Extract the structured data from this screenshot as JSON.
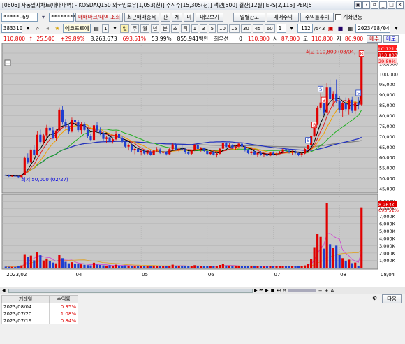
{
  "window": {
    "title": "[0606] 자동일지차트(매매내역) - KOSDAQ150 외국인보유[1,053(천)] 주식수[15,305(천)] 액면[500] 결산[12월] EPS[2,115] PER[5"
  },
  "toolbar1": {
    "account_value": "*****-69",
    "password_value": "********",
    "trade_button": "매매마크/내역 조회",
    "recent_button": "최근매매종목",
    "bal_button": "잔",
    "unexec_button": "체",
    "unexec2_button": "미",
    "memo_button": "매모보기",
    "daily_button": "일별잔고",
    "trade_profit_button": "매매수익",
    "yield_button": "수익률추이",
    "autoreg_label": "계좌연동"
  },
  "toolbar2": {
    "code_value": "383310",
    "stock_name": "에코프로에",
    "period_buttons": [
      "주",
      "월",
      "년",
      "분",
      "초",
      "틱"
    ],
    "interval_buttons": [
      "1",
      "3",
      "5",
      "10",
      "15",
      "30",
      "45",
      "60"
    ],
    "interval_input": "1",
    "count_value": "112",
    "count_total": "/543",
    "date_value": "2023/08/04"
  },
  "quote": {
    "price": "110,800",
    "arrow": "↑",
    "change": "25,500",
    "change_pct": "+29.89%",
    "volume": "8,263,673",
    "vol_ratio": "693.51%",
    "turnover": "53.99%",
    "amount": "855,941백만",
    "fund_label": "최우선",
    "prev": "0",
    "open_price": "110,800",
    "open_label": "시",
    "open_value": "87,800",
    "high_label": "고",
    "high_value": "110,800",
    "low_label": "저",
    "low_value": "86,900",
    "buy_button": "매수",
    "sell_button": "매도"
  },
  "chart_data": {
    "type": "candlestick",
    "price_axis": {
      "min": 45000,
      "max": 110000,
      "ticks": [
        "110,000",
        "105,000",
        "100,000",
        "95,000",
        "90,000",
        "85,000",
        "80,000",
        "75,000",
        "70,000",
        "65,000",
        "60,000",
        "55,000",
        "50,000",
        "45,000"
      ]
    },
    "volume_axis": {
      "ticks": [
        "9,000K",
        "8,000K",
        "7,000K",
        "6,000K",
        "5,000K",
        "4,000K",
        "3,000K",
        "2,000K",
        "1,000K"
      ]
    },
    "x_ticks": [
      "2023/02",
      "04",
      "05",
      "06",
      "07",
      "08"
    ],
    "right_labels": [
      "LC:121,60",
      "110,800",
      "29,89%"
    ],
    "volume_right_labels": [
      "8,263K",
      "693.51%"
    ],
    "bottom_right_label": "08/04",
    "annotations": {
      "high": "최고 110,800 (08/04)",
      "low": "최저 50,000 (02/27)"
    },
    "candles": [
      [
        51600,
        52000,
        51000,
        51400
      ],
      [
        51400,
        51800,
        50600,
        51000
      ],
      [
        51000,
        51500,
        50700,
        51200
      ],
      [
        51200,
        51600,
        50800,
        51100
      ],
      [
        51100,
        51300,
        50000,
        50600
      ],
      [
        50600,
        51800,
        50500,
        51700
      ],
      [
        51700,
        60500,
        51600,
        59800
      ],
      [
        59800,
        62000,
        56800,
        57600
      ],
      [
        57600,
        64800,
        57200,
        63800
      ],
      [
        63800,
        66000,
        60800,
        61300
      ],
      [
        61300,
        72800,
        61000,
        70900
      ],
      [
        70900,
        73300,
        66500,
        67400
      ],
      [
        67400,
        71500,
        66200,
        70600
      ],
      [
        70600,
        75600,
        69200,
        74200
      ],
      [
        74200,
        78000,
        72100,
        73000
      ],
      [
        73000,
        74600,
        68700,
        69400
      ],
      [
        69400,
        73800,
        68200,
        72900
      ],
      [
        72900,
        84000,
        72600,
        82900
      ],
      [
        82900,
        84800,
        75700,
        76800
      ],
      [
        76800,
        78400,
        74000,
        75100
      ],
      [
        75100,
        76000,
        71200,
        72400
      ],
      [
        72400,
        79100,
        72000,
        78000
      ],
      [
        78000,
        80800,
        76500,
        77000
      ],
      [
        77000,
        78000,
        72100,
        73100
      ],
      [
        73100,
        76900,
        71300,
        76100
      ],
      [
        76100,
        76800,
        72400,
        73200
      ],
      [
        73200,
        73900,
        69200,
        70300
      ],
      [
        70300,
        71400,
        67700,
        68400
      ],
      [
        68400,
        76300,
        68100,
        75400
      ],
      [
        75400,
        77000,
        72200,
        73000
      ],
      [
        73000,
        74400,
        70700,
        71700
      ],
      [
        71700,
        72400,
        68000,
        68900
      ],
      [
        68900,
        70200,
        66800,
        69600
      ],
      [
        69600,
        71000,
        67400,
        67900
      ],
      [
        67900,
        69200,
        66700,
        68700
      ],
      [
        68700,
        72600,
        68300,
        71300
      ],
      [
        71300,
        72000,
        68800,
        69400
      ],
      [
        69400,
        70400,
        67000,
        67600
      ],
      [
        67600,
        68200,
        64500,
        65200
      ],
      [
        65200,
        66600,
        63400,
        65900
      ],
      [
        65900,
        66400,
        62800,
        63400
      ],
      [
        63400,
        64700,
        61600,
        64100
      ],
      [
        64100,
        64800,
        62200,
        62700
      ],
      [
        62700,
        63700,
        61000,
        63200
      ],
      [
        63200,
        63500,
        61500,
        61900
      ],
      [
        61900,
        63300,
        61400,
        62800
      ],
      [
        62800,
        63400,
        60900,
        61400
      ],
      [
        61400,
        63700,
        61200,
        63300
      ],
      [
        63300,
        65000,
        62600,
        63900
      ],
      [
        63900,
        64400,
        61700,
        62200
      ],
      [
        62200,
        63100,
        61600,
        62600
      ],
      [
        62600,
        63000,
        61000,
        61600
      ],
      [
        61600,
        64400,
        61200,
        64000
      ],
      [
        64000,
        67000,
        63500,
        66200
      ],
      [
        66200,
        66800,
        63200,
        63700
      ],
      [
        63700,
        64700,
        62400,
        64200
      ],
      [
        64200,
        65800,
        63400,
        63900
      ],
      [
        63900,
        64600,
        61800,
        62500
      ],
      [
        62500,
        63000,
        61100,
        61800
      ],
      [
        61800,
        63800,
        61300,
        63400
      ],
      [
        63400,
        66500,
        63000,
        65900
      ],
      [
        65900,
        66200,
        63600,
        64100
      ],
      [
        64100,
        65000,
        62800,
        64500
      ],
      [
        64500,
        64700,
        62700,
        63100
      ],
      [
        63100,
        63700,
        61400,
        61700
      ],
      [
        61700,
        62900,
        61400,
        62600
      ],
      [
        62600,
        63300,
        61000,
        61400
      ],
      [
        61400,
        62200,
        60000,
        61800
      ],
      [
        61800,
        64600,
        61500,
        64200
      ],
      [
        64200,
        67900,
        63900,
        66900
      ],
      [
        66900,
        67500,
        64400,
        65000
      ],
      [
        65000,
        66800,
        64600,
        66100
      ],
      [
        66100,
        66400,
        64200,
        64700
      ],
      [
        64700,
        65700,
        63500,
        65200
      ],
      [
        65200,
        67200,
        64800,
        66600
      ],
      [
        66600,
        67300,
        64800,
        65200
      ],
      [
        65200,
        65600,
        62900,
        63400
      ],
      [
        63400,
        64100,
        61700,
        62100
      ],
      [
        62100,
        63200,
        61300,
        62800
      ],
      [
        62800,
        63400,
        61100,
        61500
      ],
      [
        61500,
        62600,
        60300,
        62200
      ],
      [
        62200,
        63100,
        60900,
        61300
      ],
      [
        61300,
        62000,
        60100,
        61600
      ],
      [
        61600,
        62400,
        60500,
        60900
      ],
      [
        60900,
        62700,
        60600,
        62300
      ],
      [
        62300,
        62900,
        61000,
        61500
      ],
      [
        61500,
        62300,
        60700,
        61900
      ],
      [
        61900,
        63100,
        61600,
        62600
      ],
      [
        62600,
        64400,
        62300,
        63900
      ],
      [
        63900,
        64700,
        62800,
        63200
      ],
      [
        63200,
        63800,
        61900,
        62400
      ],
      [
        62400,
        63300,
        61200,
        62900
      ],
      [
        62900,
        63500,
        61600,
        62100
      ],
      [
        62100,
        62800,
        60700,
        61200
      ],
      [
        61200,
        62200,
        60300,
        61900
      ],
      [
        61900,
        64600,
        61600,
        64100
      ],
      [
        64100,
        66200,
        63700,
        65900
      ],
      [
        65900,
        70900,
        65400,
        70200
      ],
      [
        70200,
        76600,
        69800,
        75800
      ],
      [
        75800,
        84800,
        75400,
        83900
      ],
      [
        83900,
        90800,
        82600,
        86300
      ],
      [
        86300,
        88500,
        80300,
        81600
      ],
      [
        81600,
        95700,
        81200,
        93500
      ],
      [
        93500,
        97400,
        86200,
        88100
      ],
      [
        88100,
        91800,
        84300,
        90600
      ],
      [
        90600,
        97400,
        86100,
        87200
      ],
      [
        87200,
        89300,
        81500,
        82700
      ],
      [
        82700,
        86800,
        79400,
        85900
      ],
      [
        85900,
        88700,
        82000,
        83100
      ],
      [
        83100,
        88500,
        80600,
        87600
      ],
      [
        87600,
        89000,
        81200,
        82300
      ],
      [
        82300,
        87200,
        80700,
        86400
      ],
      [
        86400,
        88900,
        83100,
        85300
      ],
      [
        85300,
        110800,
        84800,
        110800
      ]
    ],
    "volumes": [
      150,
      130,
      120,
      110,
      260,
      320,
      1850,
      1500,
      1650,
      1000,
      2100,
      1700,
      980,
      1250,
      900,
      700,
      600,
      1800,
      1300,
      800,
      600,
      750,
      520,
      580,
      460,
      400,
      360,
      330,
      680,
      420,
      380,
      330,
      300,
      340,
      280,
      420,
      300,
      280,
      330,
      260,
      270,
      220,
      250,
      230,
      210,
      230,
      220,
      260,
      280,
      230,
      210,
      220,
      280,
      420,
      270,
      220,
      250,
      230,
      210,
      240,
      350,
      230,
      210,
      220,
      200,
      210,
      200,
      230,
      380,
      520,
      300,
      260,
      220,
      230,
      290,
      240,
      200,
      210,
      190,
      210,
      200,
      190,
      180,
      180,
      200,
      190,
      190,
      210,
      260,
      220,
      190,
      200,
      190,
      210,
      190,
      320,
      560,
      1200,
      2800,
      4600,
      4200,
      2600,
      8800,
      3200,
      2700,
      3000,
      1800,
      1300,
      900,
      1100,
      620,
      700,
      280,
      8200
    ],
    "markers": [
      {
        "label": "S",
        "idx": 96
      },
      {
        "label": "B",
        "idx": 98
      },
      {
        "label": "S",
        "idx": 100
      },
      {
        "label": "B",
        "idx": 101
      },
      {
        "label": "S",
        "idx": 112
      },
      {
        "label": "B",
        "idx": 113
      }
    ]
  },
  "bottom": {
    "next_button": "다음",
    "columns": [
      "거래일",
      "수익률"
    ],
    "rows": [
      {
        "date": "2023/08/04",
        "value": "0.35%"
      },
      {
        "date": "2023/07/20",
        "value": "1.08%"
      },
      {
        "date": "2023/07/19",
        "value": "0.84%"
      }
    ]
  },
  "colors": {
    "up": "#e00000",
    "down": "#1f3fd0",
    "ma5": "#000000",
    "ma10": "#e02020",
    "ma20": "#f0a000",
    "ma60": "#20b020",
    "ma120": "#2030c0",
    "ma240": "#808080"
  }
}
